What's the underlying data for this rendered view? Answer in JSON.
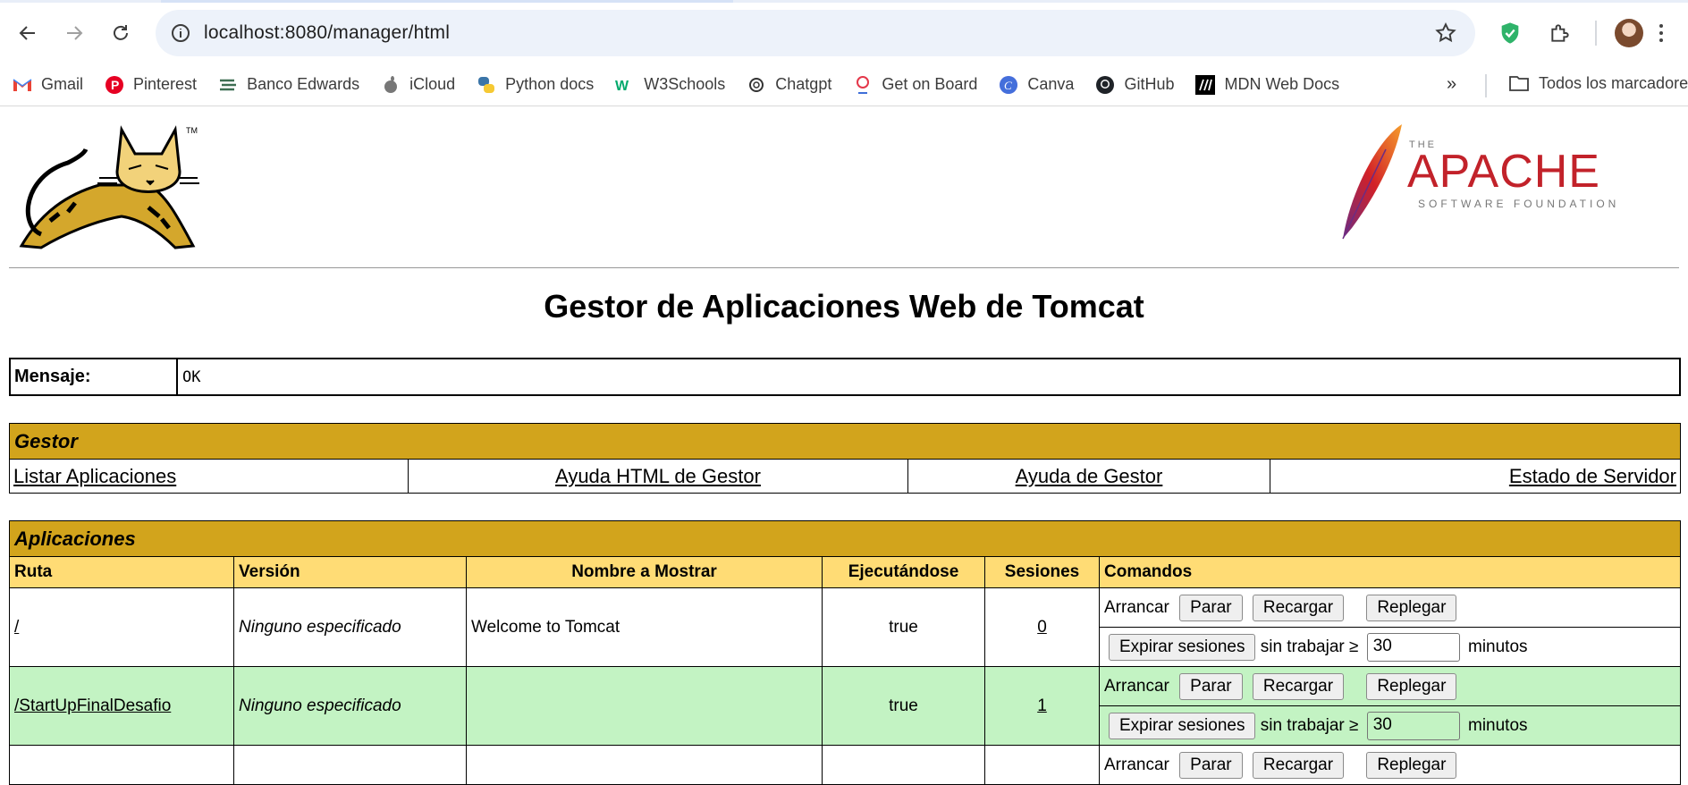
{
  "browser": {
    "url": "localhost:8080/manager/html",
    "bookmarks": [
      {
        "label": "Gmail",
        "icon": "gmail-icon"
      },
      {
        "label": "Pinterest",
        "icon": "pinterest-icon"
      },
      {
        "label": "Banco Edwards",
        "icon": "bank-icon"
      },
      {
        "label": "iCloud",
        "icon": "apple-icon"
      },
      {
        "label": "Python docs",
        "icon": "python-icon"
      },
      {
        "label": "W3Schools",
        "icon": "w3schools-icon"
      },
      {
        "label": "Chatgpt",
        "icon": "chatgpt-icon"
      },
      {
        "label": "Get on Board",
        "icon": "getonboard-icon"
      },
      {
        "label": "Canva",
        "icon": "canva-icon"
      },
      {
        "label": "GitHub",
        "icon": "github-icon"
      },
      {
        "label": "MDN Web Docs",
        "icon": "mdn-icon"
      }
    ],
    "all_bookmarks": "Todos los marcadores"
  },
  "page": {
    "title": "Gestor de Aplicaciones Web de Tomcat",
    "message_label": "Mensaje:",
    "message_value": "OK",
    "gestor": {
      "header": "Gestor",
      "links": [
        "Listar Aplicaciones",
        "Ayuda HTML de Gestor",
        "Ayuda de Gestor",
        "Estado de Servidor"
      ]
    },
    "apps": {
      "header": "Aplicaciones",
      "columns": [
        "Ruta",
        "Versión",
        "Nombre a Mostrar",
        "Ejecutándose",
        "Sesiones",
        "Comandos"
      ],
      "commands": {
        "start": "Arrancar",
        "stop": "Parar",
        "reload": "Recargar",
        "undeploy": "Replegar",
        "expire": "Expirar sesiones",
        "idle_label": "sin trabajar ≥",
        "minutes": "minutos"
      },
      "rows": [
        {
          "path": "/",
          "version": "Ninguno especificado",
          "display_name": "Welcome to Tomcat",
          "running": "true",
          "sessions": "0",
          "idle_value": "30"
        },
        {
          "path": "/StartUpFinalDesafio",
          "version": "Ninguno especificado",
          "display_name": "",
          "running": "true",
          "sessions": "1",
          "idle_value": "30"
        }
      ]
    }
  },
  "colors": {
    "section_header": "#d2a41c",
    "column_header": "#ffdc75",
    "row_alt": "#c3f3c3"
  }
}
